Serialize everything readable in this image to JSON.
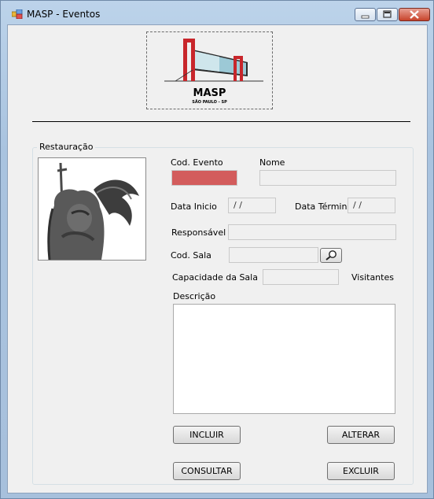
{
  "window": {
    "title": "MASP - Eventos"
  },
  "logo": {
    "name": "MASP",
    "subtitle": "SÃO PAULO - SP"
  },
  "group": {
    "title": "Restauração"
  },
  "form": {
    "cod_evento": {
      "label": "Cod. Evento",
      "value": ""
    },
    "nome": {
      "label": "Nome",
      "value": ""
    },
    "data_inicio": {
      "label": "Data Inicio",
      "value": "/ /"
    },
    "data_termino": {
      "label": "Data Término",
      "value": "/ /"
    },
    "responsavel": {
      "label": "Responsável",
      "value": ""
    },
    "cod_sala": {
      "label": "Cod. Sala",
      "value": ""
    },
    "capacidade": {
      "label": "Capacidade da Sala",
      "value": "",
      "unit": "Visitantes"
    },
    "descricao": {
      "label": "Descrição",
      "value": ""
    }
  },
  "buttons": {
    "incluir": "INCLUIR",
    "alterar": "ALTERAR",
    "consultar": "CONSULTAR",
    "excluir": "EXCLUIR"
  },
  "colors": {
    "cod_evento_field": "#d35c5c",
    "logo_red": "#c8262b",
    "window_frame": "#a9c3df"
  },
  "icons": {
    "app": "app-icon",
    "search": "magnifier-icon",
    "minimize": "minimize-icon",
    "maximize": "maximize-icon",
    "close": "close-icon"
  }
}
